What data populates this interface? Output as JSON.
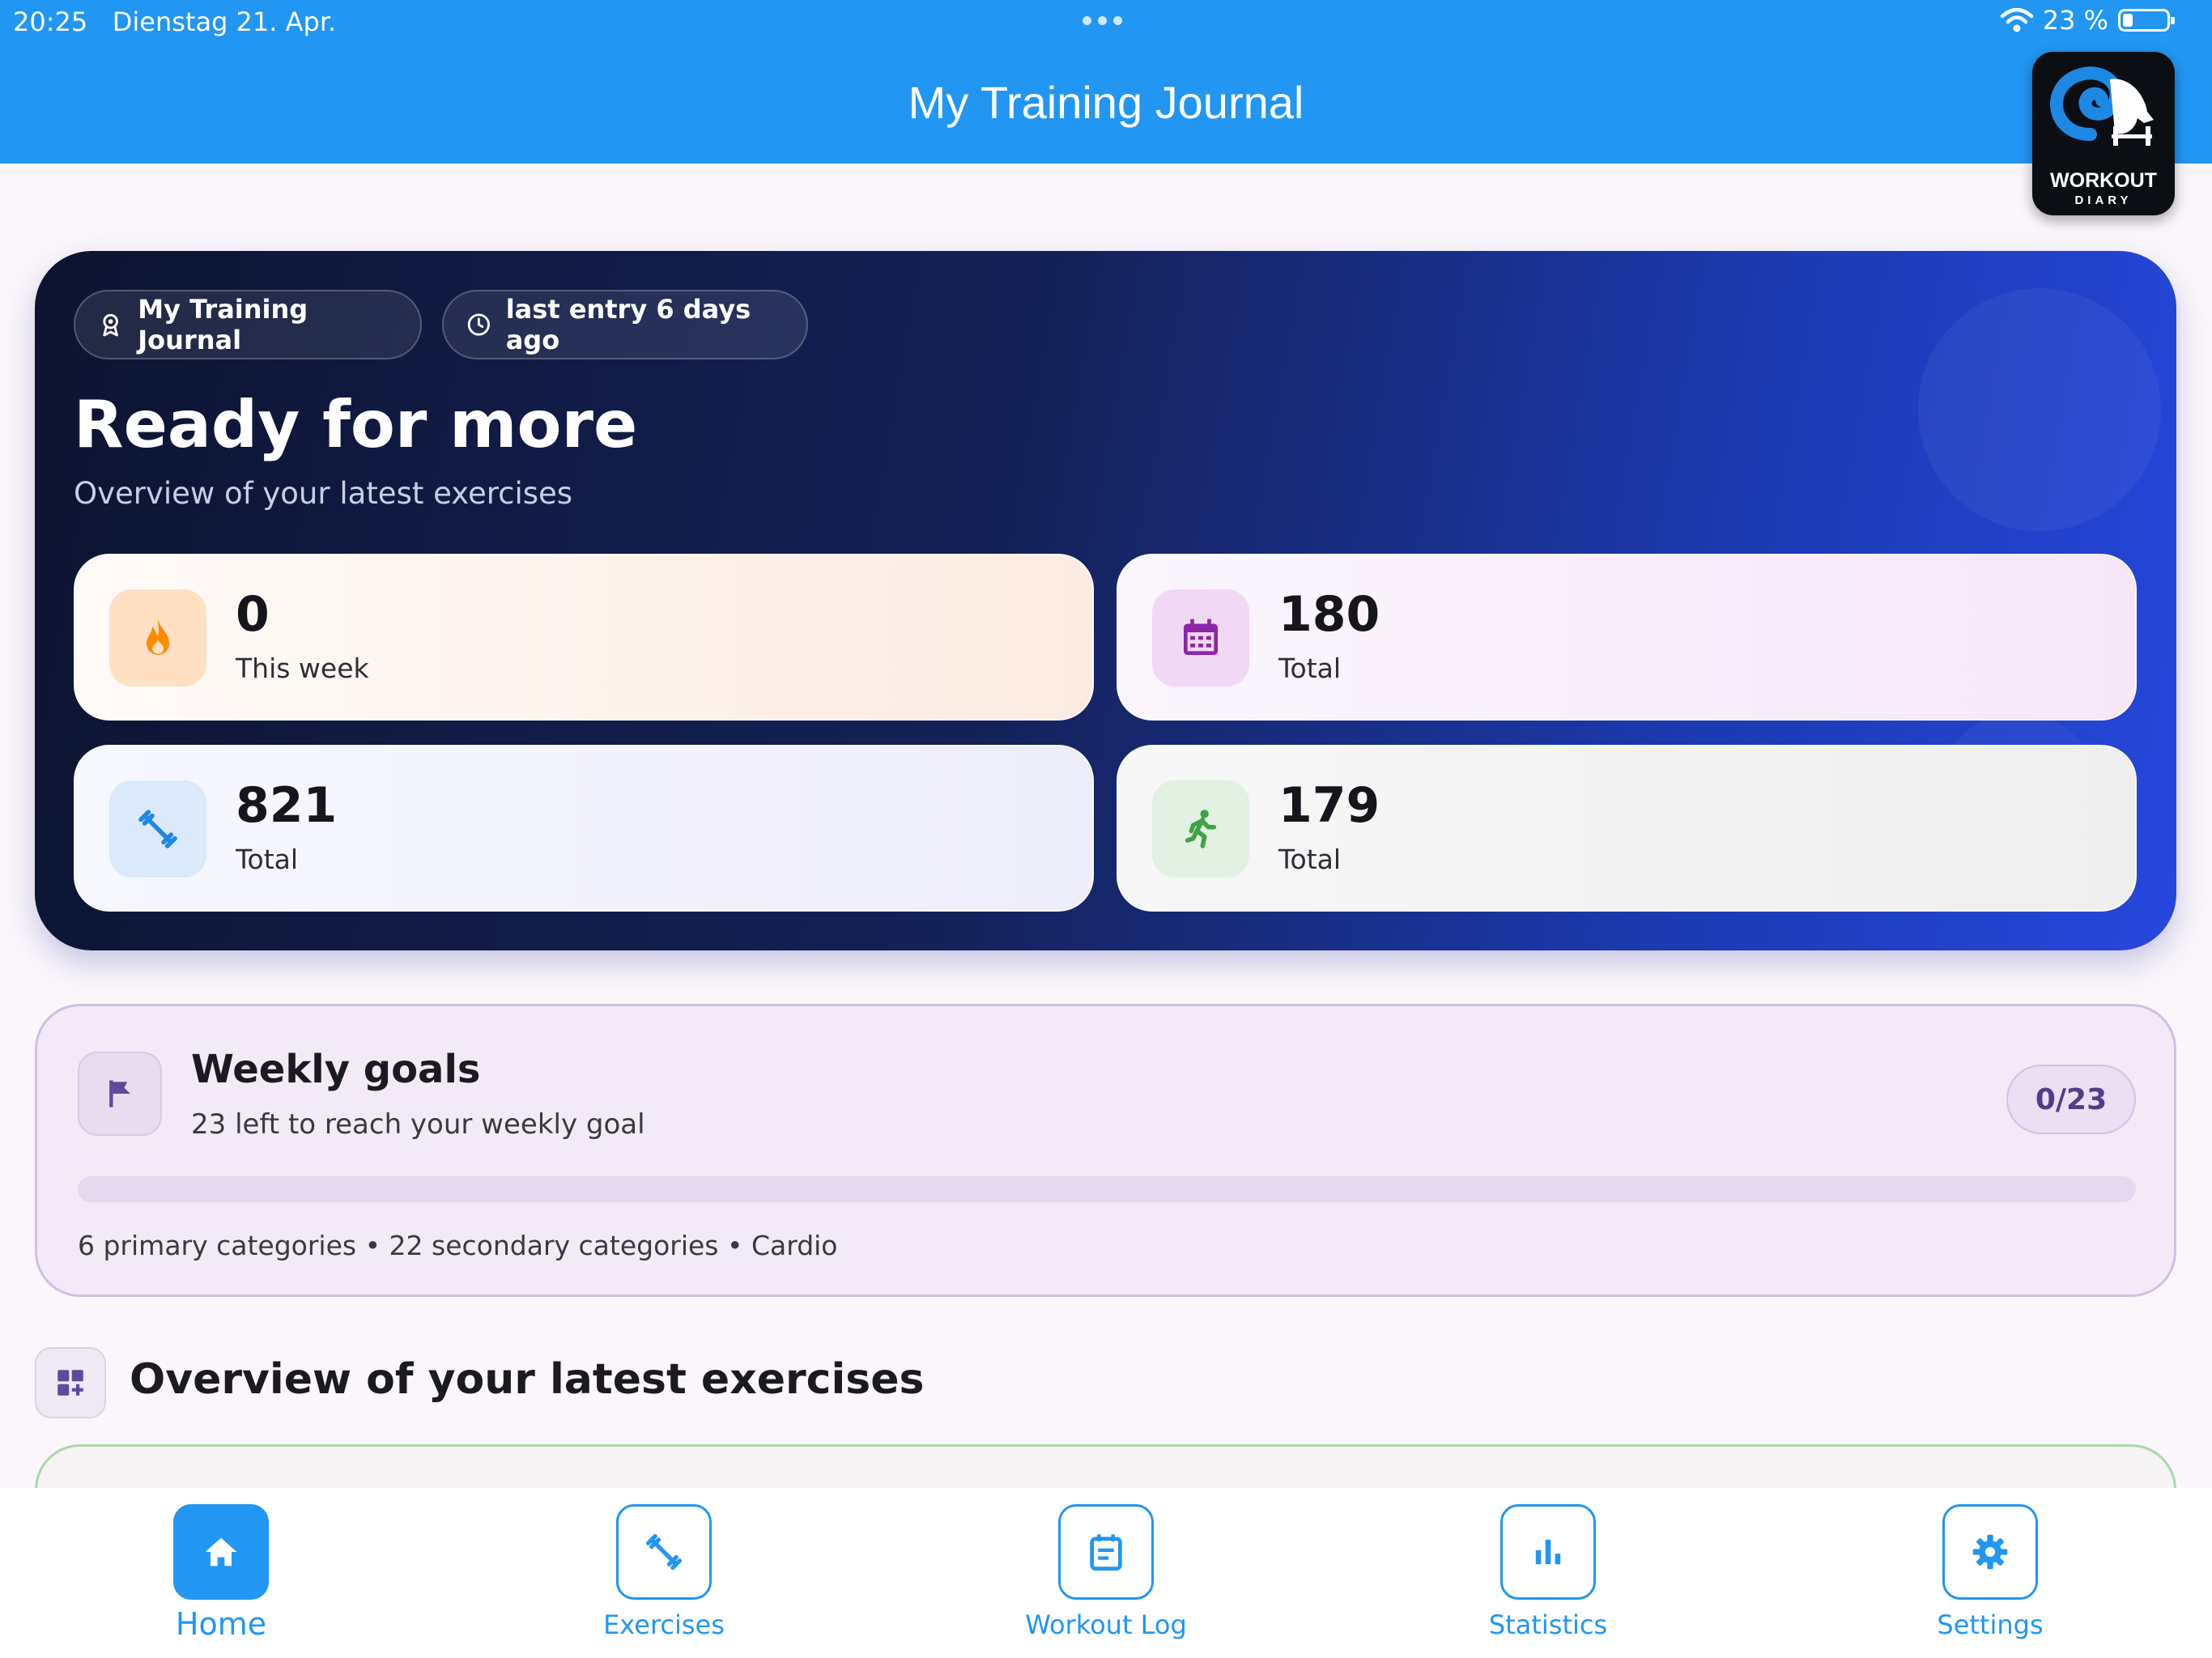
{
  "status_bar": {
    "time": "20:25",
    "date": "Dienstag 21. Apr.",
    "battery": "23 %"
  },
  "app_bar": {
    "title": "My Training Journal"
  },
  "logo": {
    "line1": "WORKOUT",
    "line2": "DIARY"
  },
  "hero": {
    "chip_journal": "My Training Journal",
    "chip_last_entry": "last entry 6 days ago",
    "title": "Ready for more",
    "subtitle": "Overview of your latest exercises"
  },
  "stats": [
    {
      "value": "0",
      "label": "This week",
      "icon": "flame-icon",
      "color": "#fb8c00"
    },
    {
      "value": "180",
      "label": "Total",
      "icon": "calendar-icon",
      "color": "#8e24aa"
    },
    {
      "value": "821",
      "label": "Total",
      "icon": "dumbbell-icon",
      "color": "#1e88e5"
    },
    {
      "value": "179",
      "label": "Total",
      "icon": "running-icon",
      "color": "#43a047"
    }
  ],
  "weekly_goals": {
    "title": "Weekly goals",
    "subtitle": "23 left to reach your weekly goal",
    "badge": "0/23",
    "progress": 0,
    "categories": "6 primary categories • 22 secondary categories • Cardio"
  },
  "overview": {
    "title": "Overview of your latest exercises"
  },
  "nav": [
    {
      "label": "Home",
      "icon": "home-icon",
      "active": true
    },
    {
      "label": "Exercises",
      "icon": "dumbbell-icon"
    },
    {
      "label": "Workout Log",
      "icon": "log-icon"
    },
    {
      "label": "Statistics",
      "icon": "bar-chart-icon"
    },
    {
      "label": "Settings",
      "icon": "gear-icon"
    }
  ],
  "colors": {
    "primary": "#2196f3",
    "goal_accent": "#4e3e8c"
  }
}
